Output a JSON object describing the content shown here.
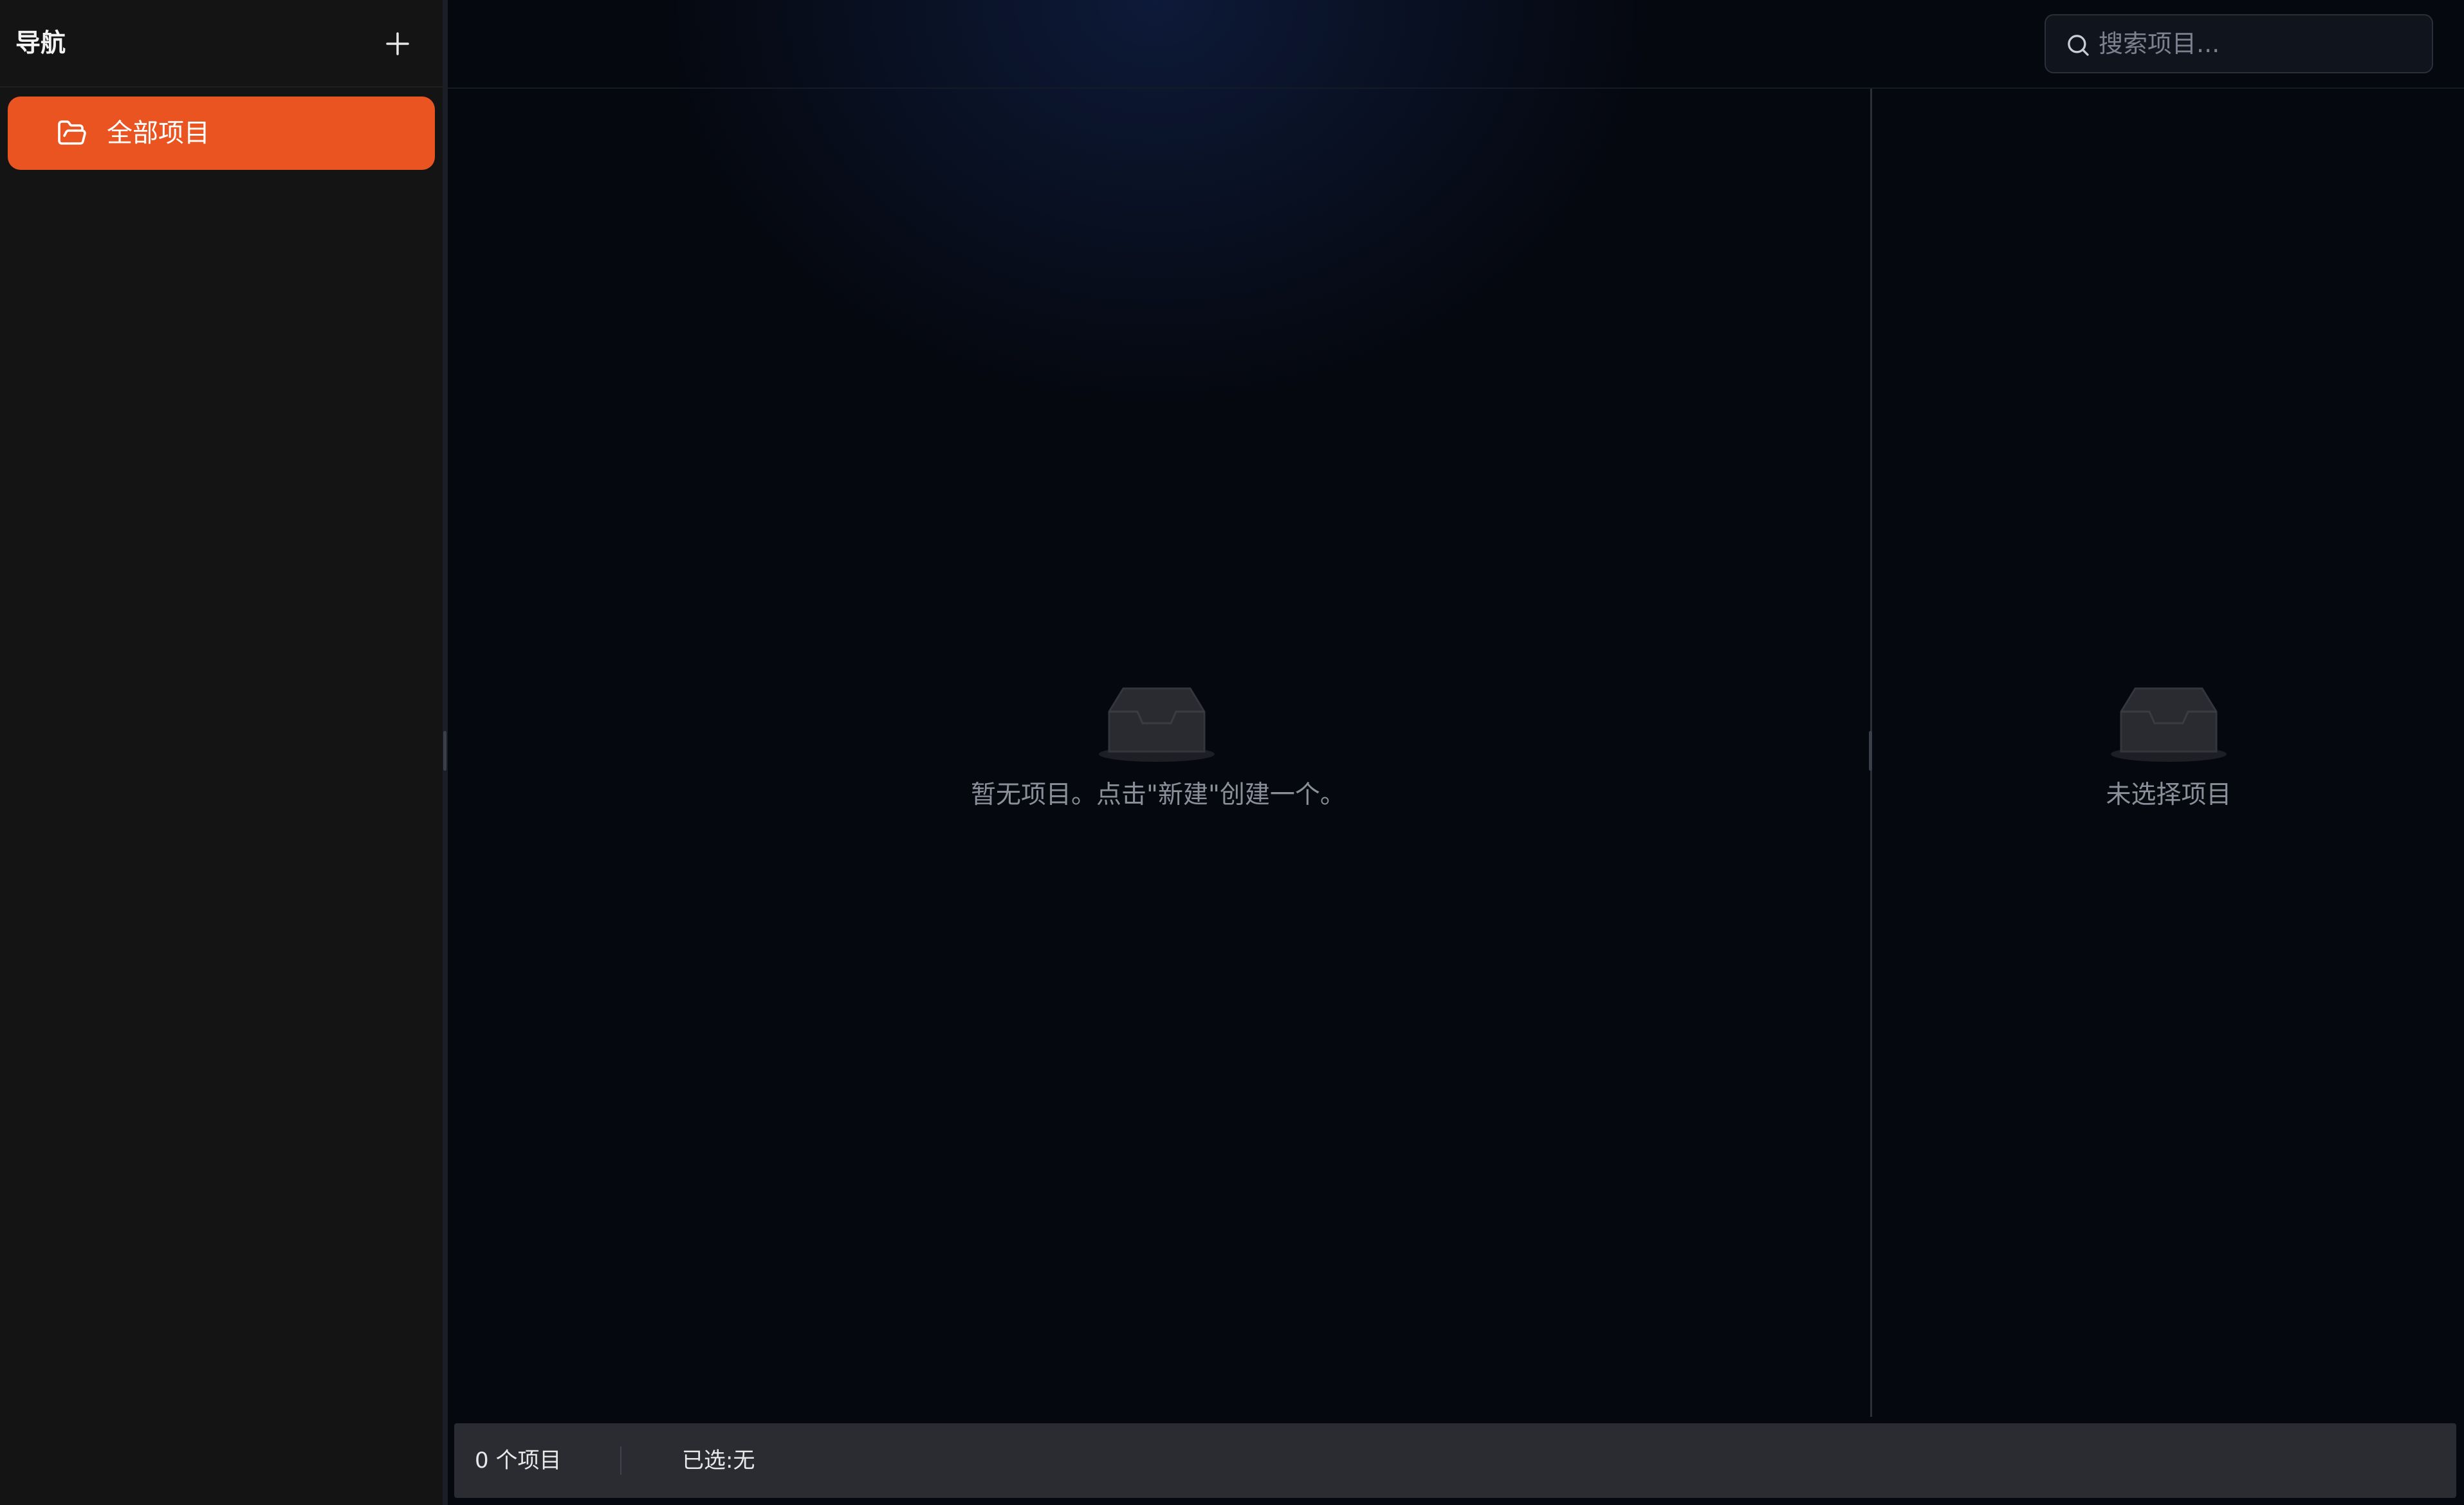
{
  "sidebar": {
    "title": "导航",
    "add_icon": "plus-icon",
    "items": [
      {
        "label": "全部项目",
        "icon": "folder-open-icon",
        "active": true
      }
    ]
  },
  "search": {
    "placeholder": "搜索项目...",
    "value": "",
    "icon": "search-icon"
  },
  "main": {
    "empty_list_text": "暂无项目。点击\"新建\"创建一个。",
    "empty_detail_text": "未选择项目",
    "empty_icon": "inbox-icon"
  },
  "statusbar": {
    "count_text": "0 个项目",
    "selected_text": "已选:无"
  },
  "colors": {
    "accent": "#e95420",
    "sidebar_bg": "#141414",
    "main_bg": "#05080f",
    "statusbar_bg": "#2b2c32"
  }
}
